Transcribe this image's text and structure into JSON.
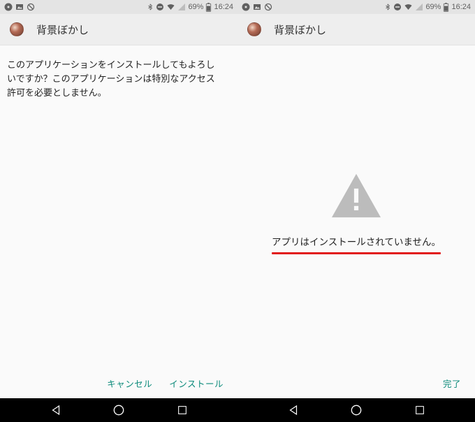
{
  "status": {
    "battery_text": "69%",
    "time": "16:24"
  },
  "app": {
    "title": "背景ぼかし"
  },
  "left": {
    "message": "このアプリケーションをインストールしてもよろしいですか？このアプリケーションは特別なアクセス許可を必要としません。",
    "cancel_label": "キャンセル",
    "install_label": "インストール"
  },
  "right": {
    "error_text": "アプリはインストールされていません。",
    "done_label": "完了"
  },
  "icons": {
    "music": "music-icon",
    "picture": "picture-icon",
    "nosign": "no-sign-icon",
    "bluetooth": "bluetooth-icon",
    "dnd": "do-not-disturb-icon",
    "wifi": "wifi-icon",
    "signal": "signal-icon",
    "battery": "battery-icon",
    "back": "back-icon",
    "home": "home-icon",
    "recent": "recent-icon",
    "warning": "warning-triangle-icon"
  }
}
